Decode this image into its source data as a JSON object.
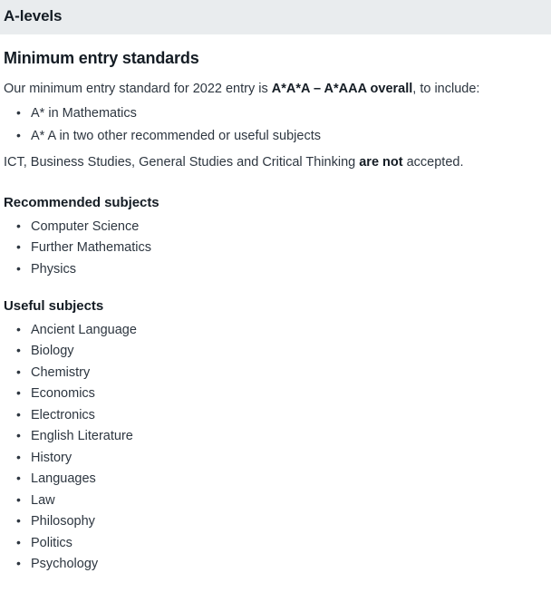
{
  "header": {
    "title": "A-levels"
  },
  "main": {
    "section_title": "Minimum entry standards",
    "intro": {
      "before_bold": "Our minimum entry standard for 2022 entry is ",
      "bold": "A*A*A  – A*AAA overall",
      "after_bold": ", to include:"
    },
    "entry_requirements": [
      "A* in Mathematics",
      "A* A in two other recommended or useful subjects"
    ],
    "excluded_note": {
      "before_bold": "ICT, Business Studies, General Studies and Critical Thinking ",
      "bold": "are not",
      "after_bold": " accepted."
    },
    "recommended": {
      "title": "Recommended subjects",
      "items": [
        "Computer Science",
        "Further Mathematics",
        "Physics"
      ]
    },
    "useful": {
      "title": "Useful subjects",
      "items": [
        "Ancient Language",
        "Biology",
        "Chemistry",
        "Economics",
        "Electronics",
        "English Literature",
        "History",
        "Languages",
        "Law",
        "Philosophy",
        "Politics",
        "Psychology"
      ]
    }
  }
}
